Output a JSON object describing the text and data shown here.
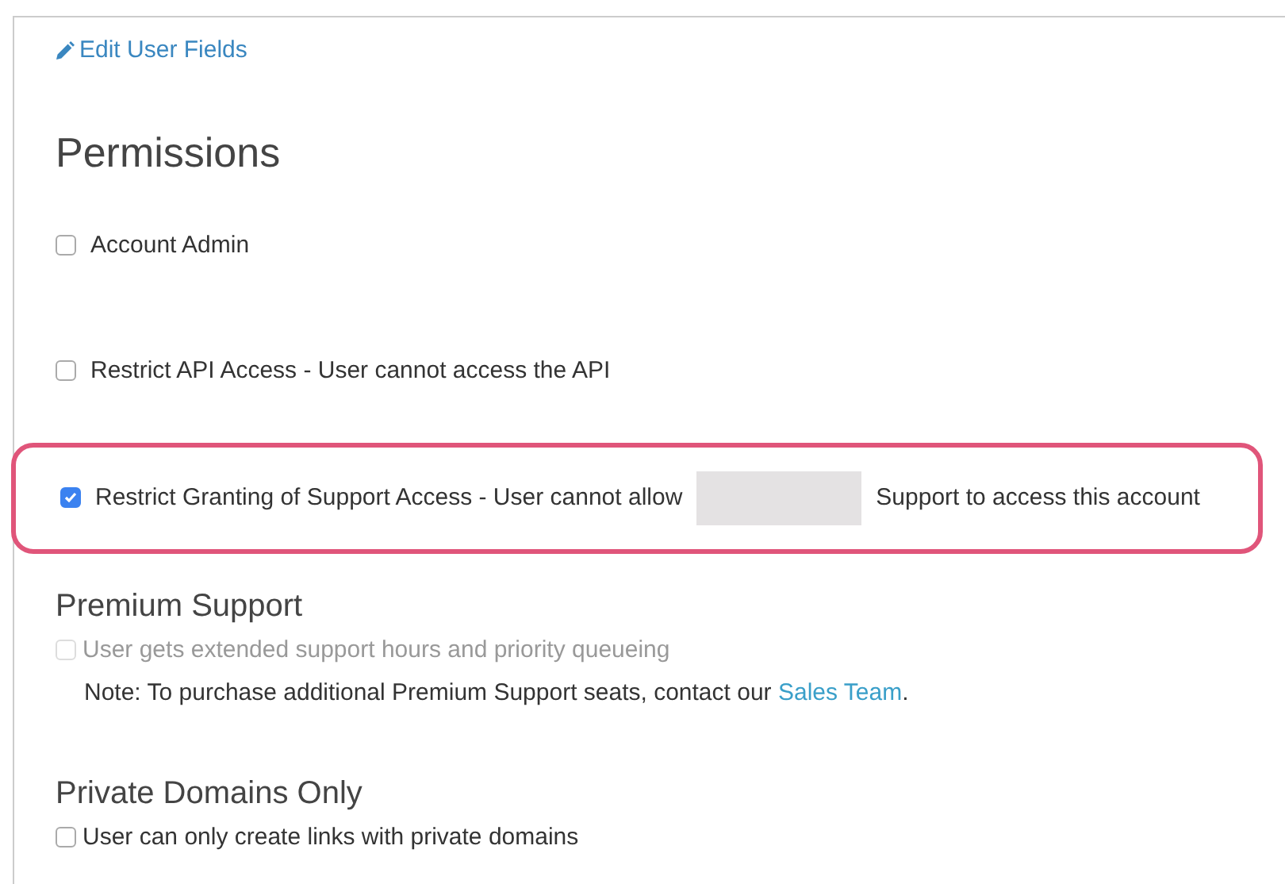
{
  "edit_link": "Edit User Fields",
  "heading": "Permissions",
  "permissions": [
    {
      "label": "Account Admin",
      "checked": false,
      "highlighted": false
    },
    {
      "label": "Restrict API Access - User cannot access the API",
      "checked": false,
      "highlighted": false
    },
    {
      "label": "Restrict Granting of Support Access - User cannot allow",
      "label_after": "Support to access this account",
      "checked": true,
      "highlighted": true
    }
  ],
  "premium_support": {
    "heading": "Premium Support",
    "option": {
      "label": "User gets extended support hours and priority queueing",
      "checked": false,
      "disabled": true
    },
    "note": {
      "text": "Note: To purchase additional Premium Support seats, contact our",
      "link": "Sales Team",
      "after": "."
    }
  },
  "private_domains": {
    "heading": "Private Domains Only",
    "option": {
      "label": "User can only create links with private domains",
      "checked": false,
      "disabled": false
    }
  }
}
